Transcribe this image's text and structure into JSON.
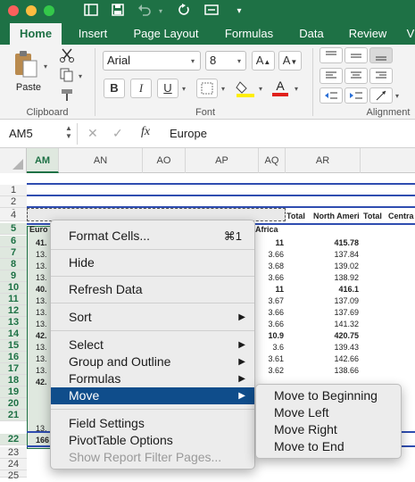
{
  "titlebar": {
    "icons": [
      "sidebar-icon",
      "save-icon",
      "undo-icon",
      "undo-dropdown-icon",
      "redo-icon",
      "print-preview-icon",
      "customize-dropdown-icon"
    ]
  },
  "tabs": [
    "Home",
    "Insert",
    "Page Layout",
    "Formulas",
    "Data",
    "Review",
    "V"
  ],
  "ribbon": {
    "paste_label": "Paste",
    "clipboard_label": "Clipboard",
    "font_name": "Arial",
    "font_size": "8",
    "font_label": "Font",
    "alignment_label": "Alignment",
    "bold": "B",
    "italic": "I",
    "underline": "U",
    "grow_font": "A",
    "shrink_font": "A",
    "font_color": "A"
  },
  "formula_bar": {
    "name_box": "AM5",
    "fx": "fx",
    "value": "Europe"
  },
  "columns": [
    "AM",
    "AN",
    "AO",
    "AP",
    "AQ",
    "AR"
  ],
  "rows": [
    "1",
    "2",
    "3",
    "4",
    "5",
    "6",
    "7",
    "8",
    "9",
    "10",
    "11",
    "12",
    "13",
    "14",
    "15",
    "16",
    "17",
    "18",
    "19",
    "20",
    "21",
    "22",
    "23",
    "24",
    "25"
  ],
  "cells": {
    "r4_aq": "Total",
    "r4_ar": "North Ameri",
    "r4_as": "Total",
    "r4_at": "Centra",
    "r5_am": "Euro",
    "r5_ap": "Africa",
    "am_col": [
      "41.",
      "13.",
      "13.",
      "13.",
      "40.",
      "13.",
      "13.",
      "13.",
      "42.",
      "13.",
      "13.",
      "13.",
      "42.",
      "",
      "",
      "13.",
      "166"
    ],
    "aq_col": [
      "11",
      "3.66",
      "3.68",
      "3.66",
      "11",
      "3.67",
      "3.66",
      "3.66",
      "10.9",
      "3.6",
      "3.61",
      "3.62"
    ],
    "ar_col": [
      "415.78",
      "137.84",
      "139.02",
      "138.92",
      "416.1",
      "137.09",
      "137.69",
      "141.32",
      "420.75",
      "139.43",
      "142.66",
      "138.66"
    ]
  },
  "context_menu": {
    "items": [
      {
        "label": "Format Cells...",
        "shortcut": "⌘1"
      },
      {
        "label": "Hide"
      },
      {
        "label": "Refresh Data"
      },
      {
        "label": "Sort",
        "submenu": true
      },
      {
        "label": "Select",
        "submenu": true
      },
      {
        "label": "Group and Outline",
        "submenu": true
      },
      {
        "label": "Formulas",
        "submenu": true
      },
      {
        "label": "Move",
        "submenu": true,
        "highlighted": true
      },
      {
        "label": "Field Settings"
      },
      {
        "label": "PivotTable Options"
      },
      {
        "label": "Show Report Filter Pages...",
        "disabled": true
      }
    ]
  },
  "submenu": {
    "items": [
      "Move to Beginning",
      "Move Left",
      "Move Right",
      "Move to End"
    ]
  },
  "colors": {
    "accent": "#1e7145",
    "menu_highlight": "#0f4d8b",
    "blue_border": "#2f4db0"
  }
}
